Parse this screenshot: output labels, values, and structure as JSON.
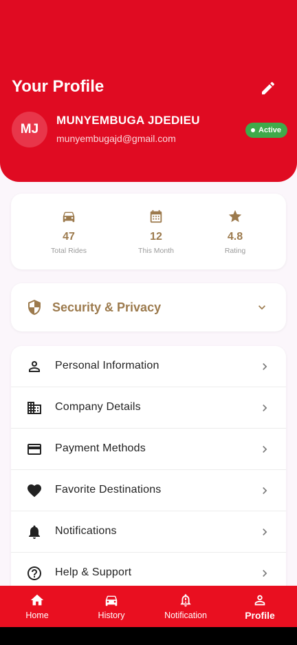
{
  "header": {
    "title": "Your Profile",
    "avatar_initials": "MJ",
    "user_name": "MUNYEMBUGA JDEDIEU",
    "user_email": "munyembugajd@gmail.com",
    "status": "Active",
    "colors": {
      "background": "#e00b22",
      "status": "#3faa4a"
    }
  },
  "stats": [
    {
      "icon": "car-icon",
      "value": "47",
      "label": "Total Rides"
    },
    {
      "icon": "calendar-icon",
      "value": "12",
      "label": "This Month"
    },
    {
      "icon": "star-icon",
      "value": "4.8",
      "label": "Rating"
    }
  ],
  "security": {
    "label": "Security & Privacy",
    "icon": "shield-icon"
  },
  "menu": [
    {
      "label": "Personal Information",
      "icon": "person-icon"
    },
    {
      "label": "Company Details",
      "icon": "building-icon"
    },
    {
      "label": "Payment Methods",
      "icon": "credit-card-icon"
    },
    {
      "label": "Favorite Destinations",
      "icon": "heart-icon"
    },
    {
      "label": "Notifications",
      "icon": "bell-icon"
    },
    {
      "label": "Help & Support",
      "icon": "help-icon"
    }
  ],
  "nav": [
    {
      "label": "Home",
      "icon": "home-icon"
    },
    {
      "label": "History",
      "icon": "car-icon"
    },
    {
      "label": "Notification",
      "icon": "bell-alert-icon"
    },
    {
      "label": "Profile",
      "icon": "person-icon",
      "active": true
    }
  ],
  "colors": {
    "accent": "#9c7a4d",
    "nav_background": "#e90f20"
  }
}
